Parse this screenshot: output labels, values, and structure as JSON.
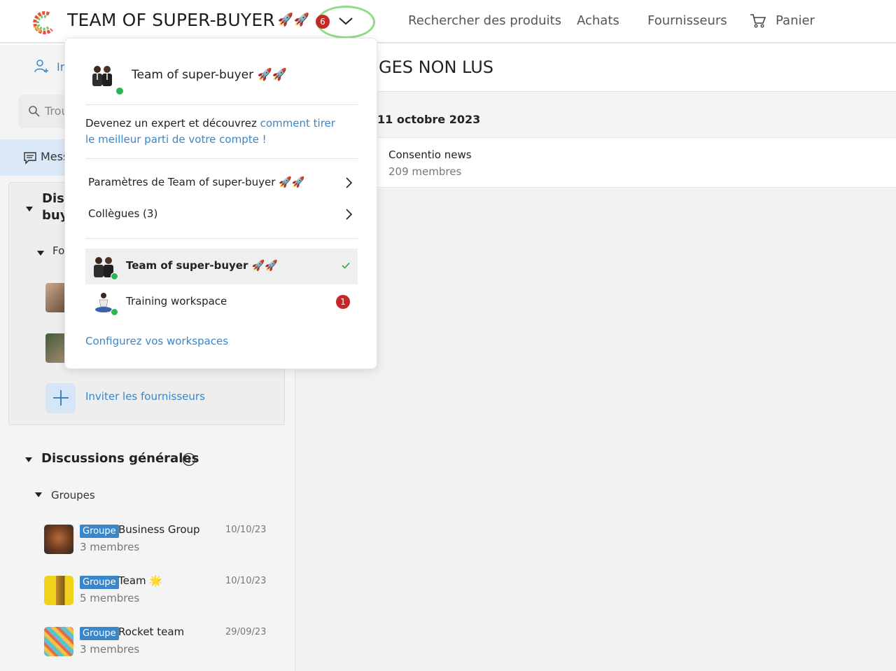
{
  "topbar": {
    "workspace_title": "TEAM OF SUPER-BUYER",
    "title_emoji": "🚀🚀",
    "notification_count": "6",
    "nav": {
      "search": "Rechercher des produits",
      "achats": "Achats",
      "fournisseurs": "Fournisseurs",
      "panier": "Panier"
    }
  },
  "sidebar": {
    "invite_label": "Ir",
    "search_placeholder": "Trou",
    "messages_label": "Mess",
    "discussions_title_line1": "Disc",
    "discussions_title_line2": "buy",
    "fournisseurs_sub": "Fo",
    "invite_suppliers": "Inviter les fournisseurs",
    "general_title": "Discussions générales",
    "groups_title": "Groupes",
    "groups": [
      {
        "badge": "Groupe",
        "name": "Business Group",
        "date": "10/10/23",
        "members": "3 membres"
      },
      {
        "badge": "Groupe",
        "name": "Team 🌟",
        "date": "10/10/23",
        "members": "5 membres"
      },
      {
        "badge": "Groupe",
        "name": "Rocket team",
        "date": "29/09/23",
        "members": "3 membres"
      }
    ]
  },
  "main": {
    "title": "GES NON LUS",
    "date_header": "11 octobre 2023",
    "news_name": "Consentio news",
    "news_members": "209 membres"
  },
  "dropdown": {
    "workspace_name": "Team of super-buyer 🚀🚀",
    "help_text": "Devenez un expert et découvrez ",
    "help_link": "comment tirer le meilleur parti de votre compte !",
    "settings_label": "Paramètres de Team of super-buyer 🚀🚀",
    "colleagues_label": "Collègues (3)",
    "workspaces": [
      {
        "name": "Team of super-buyer 🚀🚀",
        "active": true
      },
      {
        "name": "Training workspace",
        "unread": "1"
      }
    ],
    "configure_label": "Configurez vos workspaces"
  },
  "colors": {
    "accent": "#3a86c8",
    "badge_red": "#c62828",
    "online_green": "#2fb455",
    "highlight_ring": "#8fdc86"
  }
}
